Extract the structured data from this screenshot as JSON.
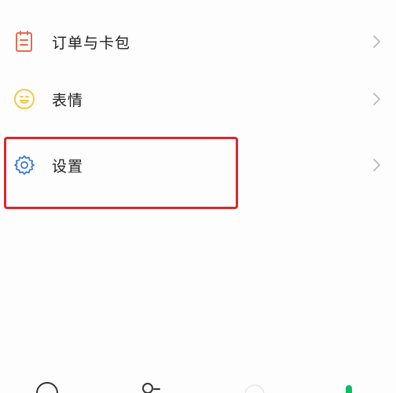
{
  "menu": {
    "items": [
      {
        "label": "订单与卡包",
        "icon": "card-icon",
        "icon_color": "#e56b4f"
      },
      {
        "label": "表情",
        "icon": "smiley-icon",
        "icon_color": "#f2c94c"
      },
      {
        "label": "设置",
        "icon": "gear-icon",
        "icon_color": "#3a7bd5"
      }
    ]
  },
  "highlight": {
    "color": "#d9282f",
    "target": "设置"
  },
  "tabbar": {
    "tabs": [
      {
        "icon": "chat-bubble-icon"
      },
      {
        "icon": "contacts-icon"
      },
      {
        "icon": "discover-icon"
      },
      {
        "icon": "me-icon",
        "active_color": "#07c160"
      }
    ]
  }
}
